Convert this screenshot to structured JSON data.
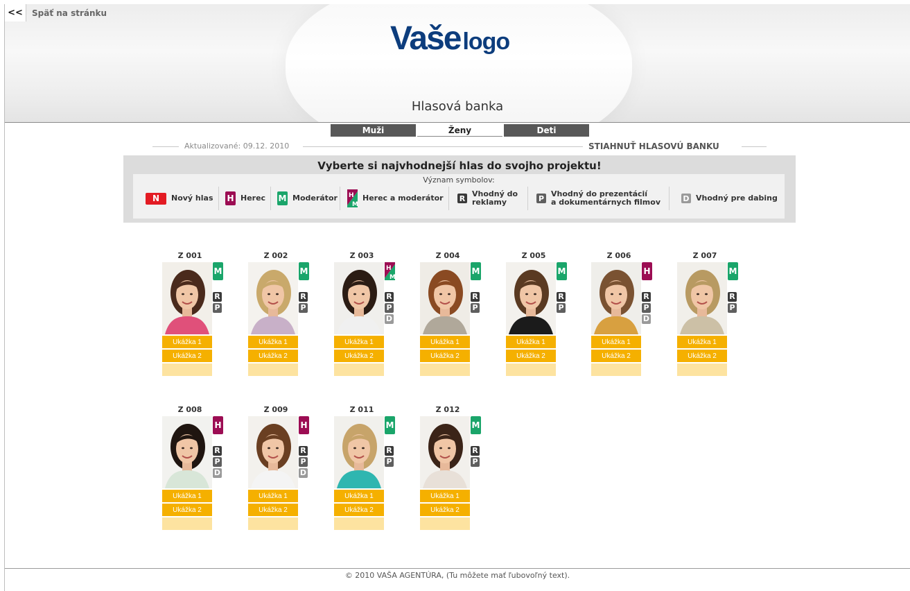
{
  "nav": {
    "back_icon": "<<",
    "back_label": "Späť na stránku"
  },
  "header": {
    "logo_main": "Vaše",
    "logo_small": "logo",
    "page_title": "Hlasová banka"
  },
  "tabs": [
    {
      "label": "Muži",
      "active": false
    },
    {
      "label": "Ženy",
      "active": true
    },
    {
      "label": "Deti",
      "active": false
    }
  ],
  "updated": "Aktualizované: 09.12. 2010",
  "download_label": "STIAHNUŤ HLASOVÚ BANKU",
  "legend": {
    "title": "Vyberte si najvhodnejší hlas do svojho projektu!",
    "subtitle": "Význam symbolov:",
    "items": [
      {
        "icon": "N",
        "label": "Nový hlas"
      },
      {
        "icon": "H",
        "label": "Herec"
      },
      {
        "icon": "M",
        "label": "Moderátor"
      },
      {
        "icon": "HM",
        "label": "Herec a moderátor"
      },
      {
        "icon": "R",
        "label_1": "Vhodný do",
        "label_2": "reklamy"
      },
      {
        "icon": "P",
        "label_1": "Vhodný do prezentácií",
        "label_2": "a dokumentárnych filmov"
      },
      {
        "icon": "D",
        "label": "Vhodný pre dabing"
      }
    ]
  },
  "sample_labels": {
    "first": "Ukážka 1",
    "second": "Ukážka 2"
  },
  "voices": [
    {
      "code": "Z 001",
      "badges": [
        "M",
        "R",
        "P"
      ]
    },
    {
      "code": "Z 002",
      "badges": [
        "M",
        "R",
        "P"
      ]
    },
    {
      "code": "Z 003",
      "badges": [
        "HM",
        "R",
        "P",
        "D"
      ]
    },
    {
      "code": "Z 004",
      "badges": [
        "M",
        "R",
        "P"
      ]
    },
    {
      "code": "Z 005",
      "badges": [
        "M",
        "R",
        "P"
      ]
    },
    {
      "code": "Z 006",
      "badges": [
        "H",
        "R",
        "P",
        "D"
      ]
    },
    {
      "code": "Z 007",
      "badges": [
        "M",
        "R",
        "P"
      ]
    },
    {
      "code": "Z 008",
      "badges": [
        "H",
        "R",
        "P",
        "D"
      ]
    },
    {
      "code": "Z 009",
      "badges": [
        "H",
        "R",
        "P",
        "D"
      ]
    },
    {
      "code": "Z 011",
      "badges": [
        "M",
        "R",
        "P"
      ]
    },
    {
      "code": "Z 012",
      "badges": [
        "M",
        "R",
        "P"
      ]
    }
  ],
  "footer": "© 2010 VAŠA AGENTÚRA, (Tu môžete mať ľubovoľný text).",
  "colors": {
    "new": "#e31b23",
    "actor": "#9c0d53",
    "host": "#1aa56a",
    "sample": "#f5b000",
    "logo": "#0d3d7d"
  }
}
